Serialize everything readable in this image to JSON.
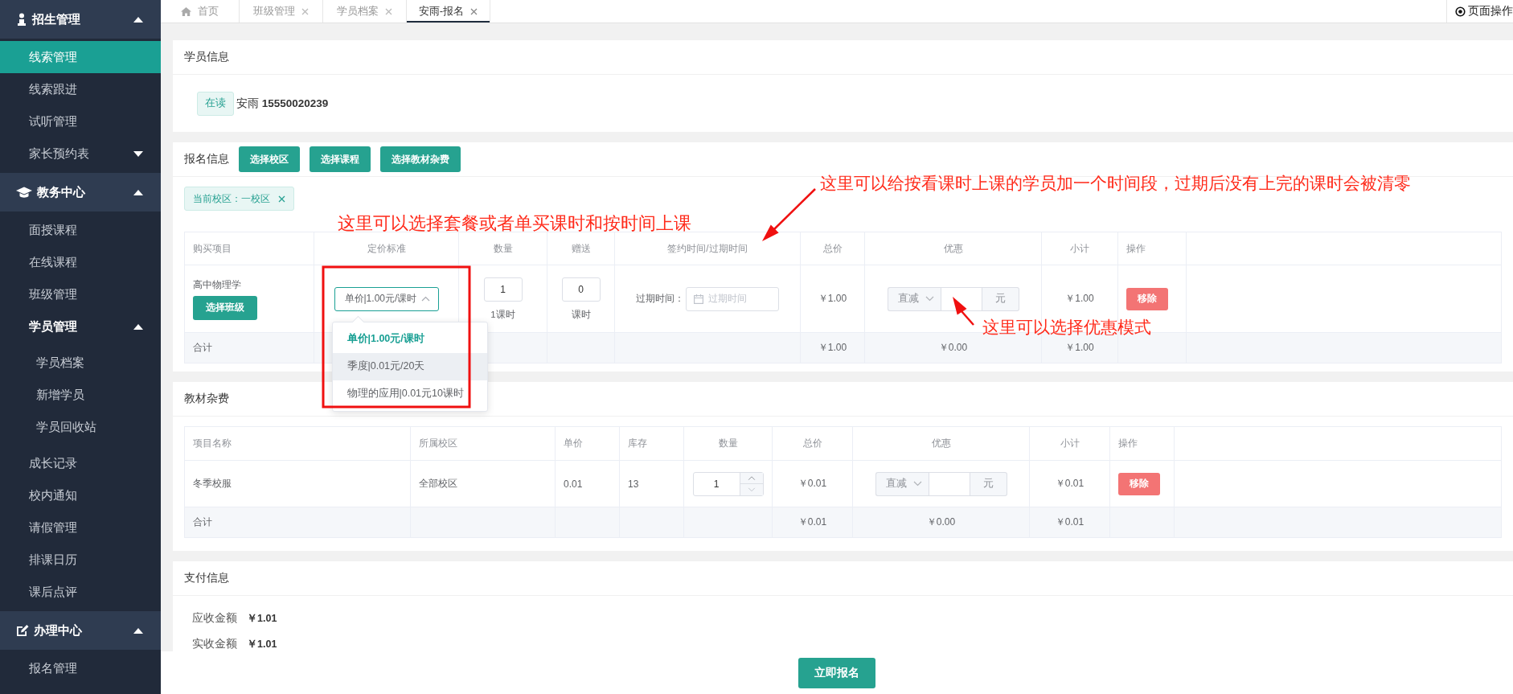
{
  "sidebar": {
    "groups": [
      {
        "label": "招生管理",
        "expanded": true,
        "items": [
          {
            "label": "线索管理",
            "selected": true
          },
          {
            "label": "线索跟进",
            "selected": false
          },
          {
            "label": "试听管理",
            "selected": false
          },
          {
            "label": "家长预约表",
            "selected": false,
            "expanded": false
          }
        ]
      },
      {
        "label": "教务中心",
        "expanded": true,
        "items": [
          {
            "label": "面授课程",
            "selected": false
          },
          {
            "label": "在线课程",
            "selected": false
          },
          {
            "label": "班级管理",
            "selected": false
          },
          {
            "label": "学员管理",
            "selected": false,
            "expanded": true,
            "children": [
              {
                "label": "学员档案",
                "selected": false
              },
              {
                "label": "新增学员",
                "selected": false
              },
              {
                "label": "学员回收站",
                "selected": false
              }
            ]
          },
          {
            "label": "成长记录",
            "selected": false
          },
          {
            "label": "校内通知",
            "selected": false
          },
          {
            "label": "请假管理",
            "selected": false
          },
          {
            "label": "排课日历",
            "selected": false
          },
          {
            "label": "课后点评",
            "selected": false
          }
        ]
      },
      {
        "label": "办理中心",
        "expanded": true,
        "items": [
          {
            "label": "报名管理",
            "selected": false
          }
        ]
      }
    ]
  },
  "tabs": [
    {
      "label": "首页",
      "kind": "home",
      "selected": false
    },
    {
      "label": "班级管理",
      "kind": "page",
      "selected": false
    },
    {
      "label": "学员档案",
      "kind": "page",
      "selected": false
    },
    {
      "label": "安雨-报名",
      "kind": "page",
      "selected": true
    }
  ],
  "page_actions": "页面操作",
  "student_info": {
    "title": "学员信息",
    "status": "在读",
    "student": "安雨 **15550020239**"
  },
  "enrollment": {
    "title": "报名信息",
    "buttons": [
      "选择校区",
      "选择课程",
      "选择教材杂费"
    ],
    "campus_tag": "当前校区：一校区",
    "table": {
      "columns": [
        "购买项目",
        "定价标准",
        "数量",
        "赠送",
        "签约时间/过期时间",
        "总价",
        "优惠",
        "小计",
        "操作"
      ],
      "rows": [
        {
          "item": "高中物理学",
          "button": "选择班级",
          "pricing": {
            "value": "单价|1.00元/课时",
            "expanded": true,
            "options": [
              {
                "label": "单价|1.00元/课时",
                "selected": true,
                "hovered": false
              },
              {
                "label": "季度|0.01元/20天",
                "selected": false,
                "hovered": true
              },
              {
                "label": "物理的应用|0.01元10课时",
                "selected": false,
                "hovered": false
              }
            ]
          },
          "quantity": "1",
          "quantity_unit": "1课时",
          "gift": "0",
          "gift_unit": "课时",
          "expire_label": "过期时间：",
          "expire_placeholder": "过期时间",
          "total": "￥1.00",
          "discount": {
            "mode": "直减",
            "unit": "元"
          },
          "subtotal": "￥1.00",
          "action": "移除"
        }
      ],
      "footer": {
        "label": "合计",
        "total": "￥1.00",
        "discount": "￥0.00",
        "subtotal": "￥1.00"
      }
    }
  },
  "materials": {
    "title": "教材杂费",
    "table": {
      "columns": [
        "项目名称",
        "所属校区",
        "单价",
        "库存",
        "数量",
        "总价",
        "优惠",
        "小计",
        "操作"
      ],
      "rows": [
        {
          "name": "冬季校服",
          "campus": "全部校区",
          "unit_price": "0.01",
          "stock": "13",
          "quantity": "1",
          "total": "￥0.01",
          "discount": {
            "mode": "直减",
            "unit": "元"
          },
          "subtotal": "￥0.01",
          "action": "移除"
        }
      ],
      "footer": {
        "label": "合计",
        "total": "￥0.01",
        "discount": "￥0.00",
        "subtotal": "￥0.01"
      }
    }
  },
  "payment": {
    "title": "支付信息",
    "rows": [
      {
        "label": "应收金额",
        "value": "￥1.01"
      },
      {
        "label": "实收金额",
        "value": "￥1.01"
      }
    ]
  },
  "submit": "立即报名",
  "annotations": [
    "这里可以选择套餐或者单买课时和按时间上课",
    "这里可以给按看课时上课的学员加一个时间段，过期后没有上完的课时会被清零",
    "这里可以选择优惠模式"
  ]
}
